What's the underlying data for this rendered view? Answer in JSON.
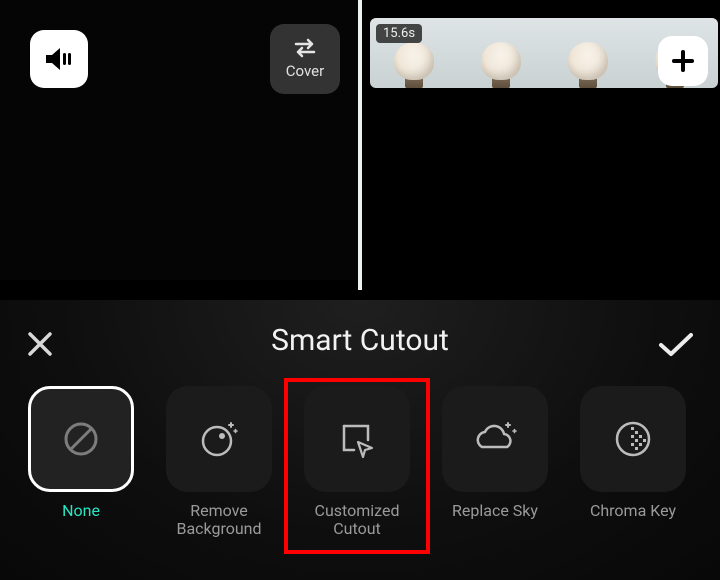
{
  "preview": {
    "mute_icon": "speaker-icon",
    "cover_label": "Cover"
  },
  "timeline": {
    "duration_badge": "15.6s",
    "add_icon": "plus-icon"
  },
  "sheet": {
    "title": "Smart Cutout",
    "close_icon": "close-icon",
    "confirm_icon": "check-icon"
  },
  "options": [
    {
      "id": "none",
      "label": "None",
      "selected": true
    },
    {
      "id": "remove",
      "label": "Remove\nBackground",
      "selected": false
    },
    {
      "id": "custom",
      "label": "Customized\nCutout",
      "selected": false,
      "highlighted": true
    },
    {
      "id": "sky",
      "label": "Replace Sky",
      "selected": false
    },
    {
      "id": "chroma",
      "label": "Chroma Key",
      "selected": false
    }
  ],
  "colors": {
    "accent": "#29e6c3",
    "highlight": "#ff0000"
  }
}
